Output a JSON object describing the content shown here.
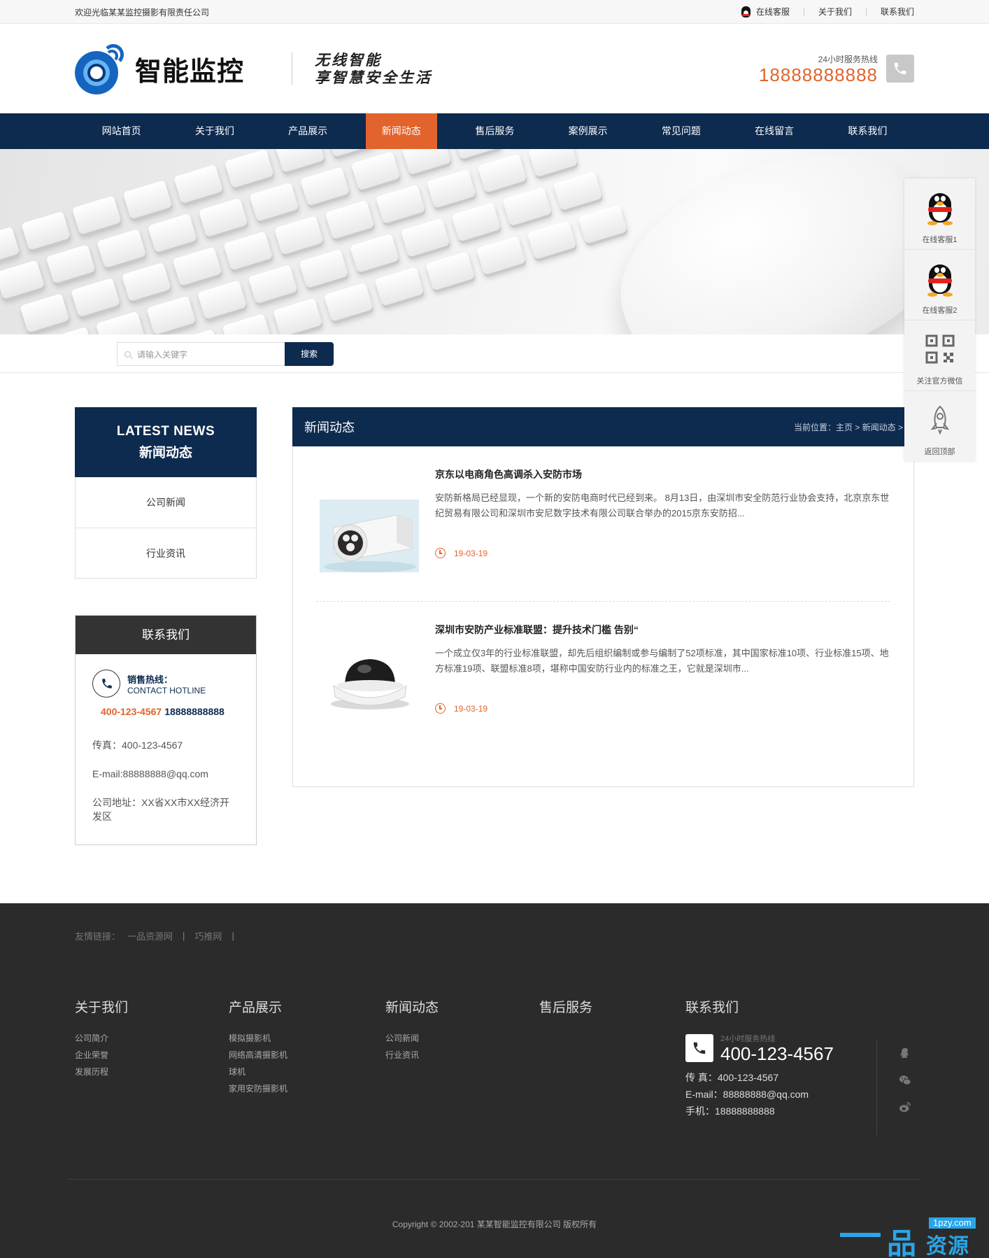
{
  "topbar": {
    "welcome": "欢迎光临某某监控摄影有限责任公司",
    "links": [
      "在线客服",
      "关于我们",
      "联系我们"
    ]
  },
  "header": {
    "logo_text": "智能监控",
    "slogan_line1": "无线智能",
    "slogan_line2": "享智慧安全生活",
    "hotline_label": "24小时服务热线",
    "hotline_number": "18888888888"
  },
  "nav": {
    "items": [
      "网站首页",
      "关于我们",
      "产品展示",
      "新闻动态",
      "售后服务",
      "案例展示",
      "常见问题",
      "在线留言",
      "联系我们"
    ],
    "active_index": 3
  },
  "search": {
    "placeholder": "请输入关键字",
    "button": "搜索"
  },
  "sidebar": {
    "cat_en": "LATEST NEWS",
    "cat_cn": "新闻动态",
    "categories": [
      "公司新闻",
      "行业资讯"
    ],
    "contact_title": "联系我们",
    "hotline_label": "销售热线：",
    "hotline_en": "CONTACT HOTLINE",
    "hotline_num1": "400-123-4567",
    "hotline_num2": "18888888888",
    "fax": "传真：400-123-4567",
    "email": "E-mail:88888888@qq.com",
    "address": "公司地址：XX省XX市XX经济开发区"
  },
  "main": {
    "title": "新闻动态",
    "breadcrumb": "当前位置：主页 > 新闻动态 >",
    "news": [
      {
        "title": "京东以电商角色高调杀入安防市场",
        "desc": "安防新格局已经显现，一个新的安防电商时代已经到来。 8月13日，由深圳市安全防范行业协会支持，北京京东世纪贸易有限公司和深圳市安尼数字技术有限公司联合举办的2015京东安防招...",
        "date": "19-03-19"
      },
      {
        "title": "深圳市安防产业标准联盟：提升技术门槛 告别“",
        "desc": "一个成立仅3年的行业标准联盟，却先后组织编制或参与编制了52项标准，其中国家标准10项、行业标准15项、地方标准19项、联盟标准8项，堪称中国安防行业内的标准之王，它就是深圳市...",
        "date": "19-03-19"
      }
    ]
  },
  "float": {
    "items": [
      "在线客服1",
      "在线客服2",
      "关注官方微信",
      "返回顶部"
    ]
  },
  "footer": {
    "friend_label": "友情链接：",
    "friend_links": [
      "一品资源网",
      "巧推网"
    ],
    "cols": [
      {
        "title": "关于我们",
        "links": [
          "公司简介",
          "企业荣誉",
          "发展历程"
        ]
      },
      {
        "title": "产品展示",
        "links": [
          "模拟摄影机",
          "网络高清摄影机",
          "球机",
          "家用安防摄影机"
        ]
      },
      {
        "title": "新闻动态",
        "links": [
          "公司新闻",
          "行业资讯"
        ]
      },
      {
        "title": "售后服务",
        "links": []
      }
    ],
    "contact_title": "联系我们",
    "hotline_label": "24小时服务热线",
    "hotline": "400-123-4567",
    "fax": "传 真：400-123-4567",
    "email": "E-mail：88888888@qq.com",
    "mobile": "手机：18888888888",
    "copyright": "Copyright © 2002-201 某某智能监控有限公司 版权所有"
  },
  "watermark": {
    "glyph": "品",
    "site": "1pzy.com",
    "name": "资源网"
  },
  "colors": {
    "navy": "#0d2a4f",
    "accent": "#e2632b",
    "footer_bg": "#2b2b2b"
  }
}
